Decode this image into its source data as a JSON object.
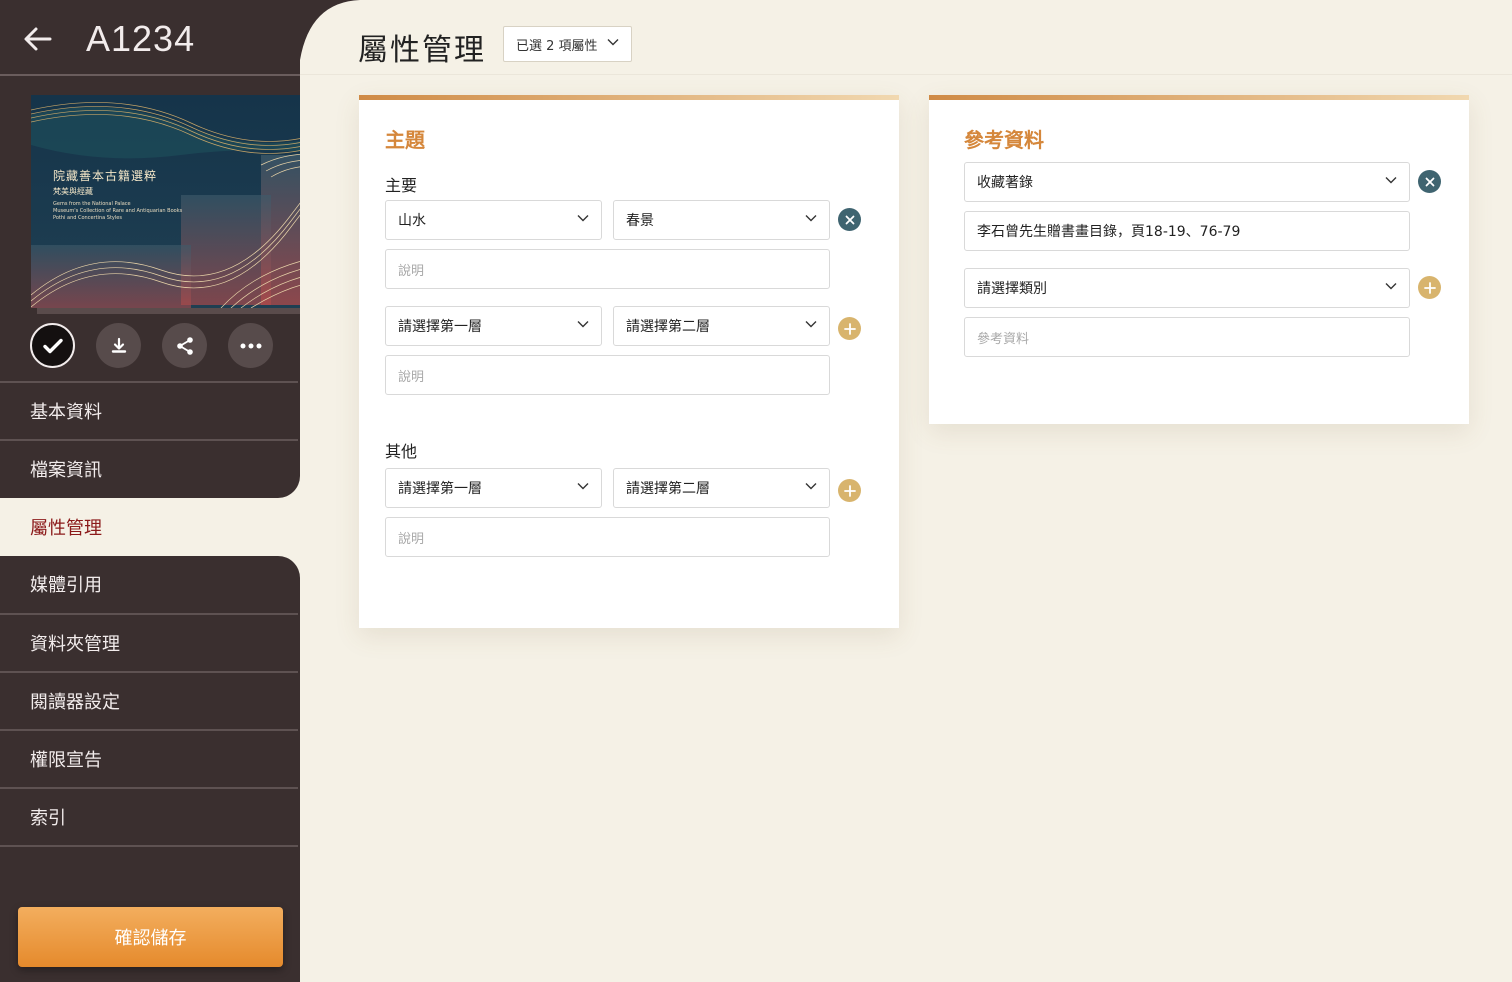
{
  "sidebar": {
    "item_id": "A1234",
    "thumbnail": {
      "title": "院藏善本古籍選粹",
      "subtitle": "梵美與經藏",
      "english_lines": [
        "Gems from the National Palace",
        "Museum's Collection of Rare and Antiquarian Books",
        "Pothi and Concertina Styles"
      ]
    },
    "nav": [
      "基本資料",
      "檔案資訊",
      "屬性管理",
      "媒體引用",
      "資料夾管理",
      "閱讀器設定",
      "權限宣告",
      "索引"
    ],
    "active_nav": "屬性管理",
    "save_label": "確認儲存"
  },
  "header": {
    "title": "屬性管理",
    "selection_label": "已選 2 項屬性"
  },
  "subject_card": {
    "title": "主題",
    "main_label": "主要",
    "rows": [
      {
        "level1": "山水",
        "level2": "春景",
        "desc_placeholder": "說明"
      },
      {
        "level1": "請選擇第一層",
        "level2": "請選擇第二層",
        "desc_placeholder": "說明"
      }
    ],
    "other_label": "其他",
    "other_row": {
      "level1": "請選擇第一層",
      "level2": "請選擇第二層",
      "desc_placeholder": "說明"
    }
  },
  "reference_card": {
    "title": "參考資料",
    "entries": [
      {
        "category": "收藏著錄",
        "value": "李石曾先生贈書畫目錄，頁18-19、76-79"
      },
      {
        "category": "請選擇類別",
        "placeholder": "參考資料"
      }
    ]
  },
  "colors": {
    "sidebar_bg": "#3a2f2f",
    "page_bg": "#f5f1e6",
    "accent_orange": "#d5873b",
    "active_nav": "#8b1a1a",
    "remove_icon": "#3f6470",
    "add_icon": "#d8b46d"
  }
}
